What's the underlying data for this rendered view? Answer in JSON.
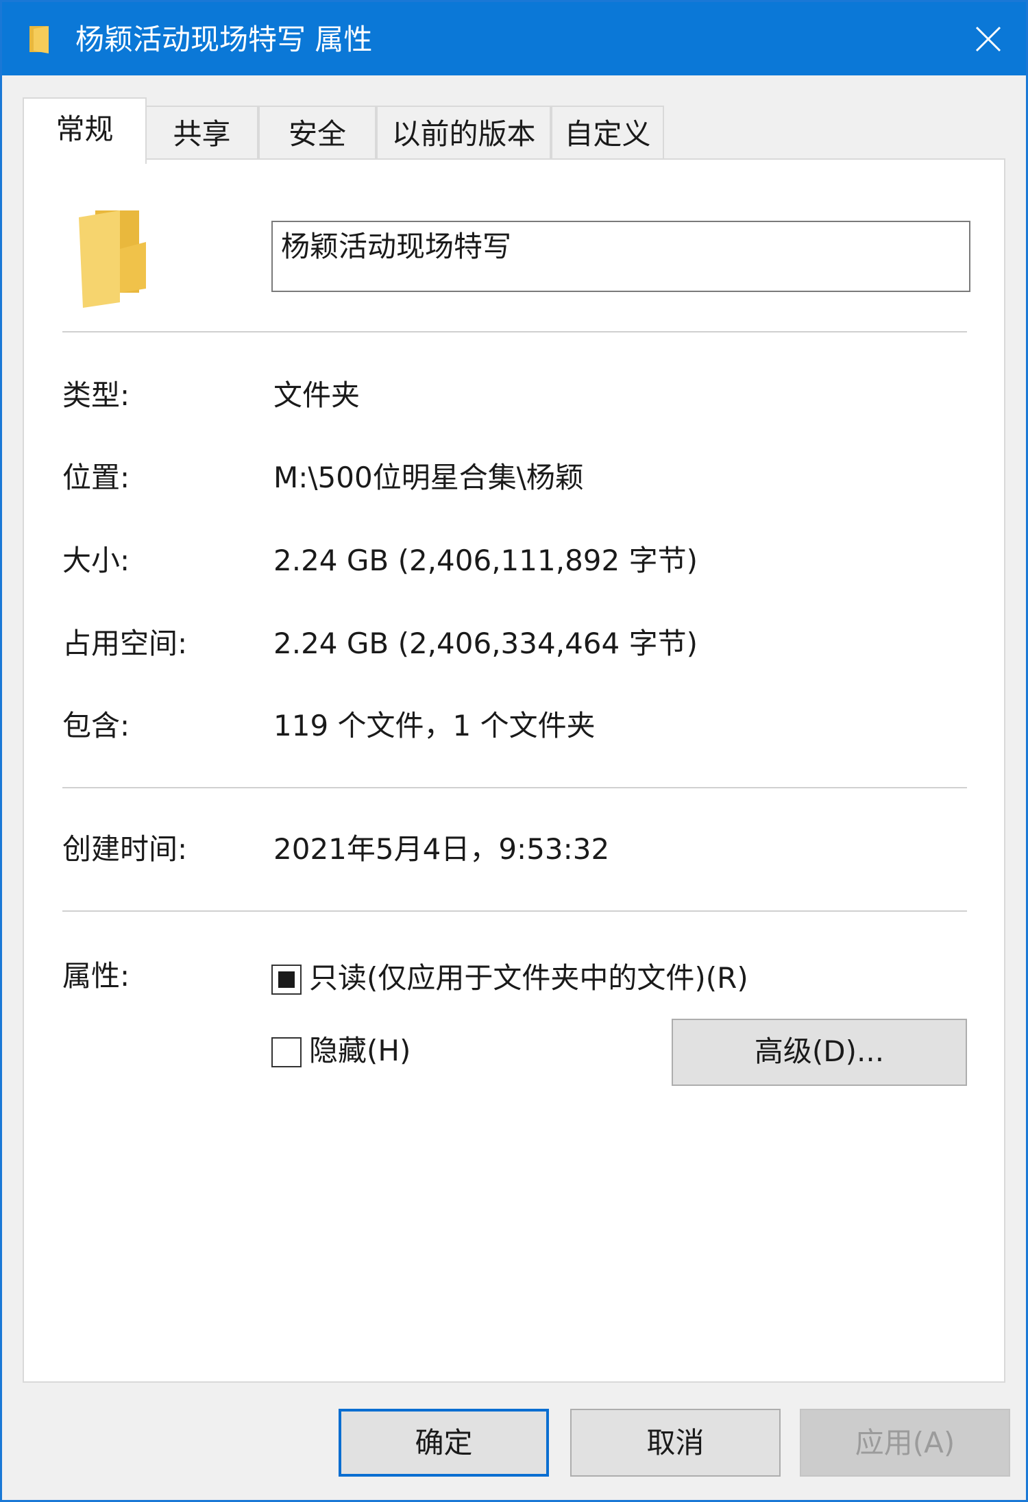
{
  "window": {
    "title": "杨颖活动现场特写 属性",
    "icons": {
      "title": "folder-icon",
      "close": "close-icon",
      "large": "folder-icon"
    }
  },
  "tabs": [
    {
      "label": "常规",
      "active": true
    },
    {
      "label": "共享",
      "active": false
    },
    {
      "label": "安全",
      "active": false
    },
    {
      "label": "以前的版本",
      "active": false
    },
    {
      "label": "自定义",
      "active": false
    }
  ],
  "general": {
    "folder_name": "杨颖活动现场特写",
    "type_label": "类型:",
    "type_value": "文件夹",
    "location_label": "位置:",
    "location_value": "M:\\500位明星合集\\杨颖",
    "size_label": "大小:",
    "size_value": "2.24 GB (2,406,111,892 字节)",
    "size_on_disk_label": "占用空间:",
    "size_on_disk_value": "2.24 GB (2,406,334,464 字节)",
    "contains_label": "包含:",
    "contains_value": "119 个文件，1 个文件夹",
    "created_label": "创建时间:",
    "created_value": "2021年5月4日，9:53:32",
    "attributes_label": "属性:",
    "readonly_label": "只读(仅应用于文件夹中的文件)(R)",
    "readonly_state": "indeterminate",
    "hidden_label": "隐藏(H)",
    "hidden_checked": false,
    "advanced_label": "高级(D)..."
  },
  "buttons": {
    "ok": "确定",
    "cancel": "取消",
    "apply": "应用(A)"
  },
  "colors": {
    "titlebar": "#0b78d7",
    "focus_border": "#0a6ed1",
    "folder": "#f2c94c"
  }
}
